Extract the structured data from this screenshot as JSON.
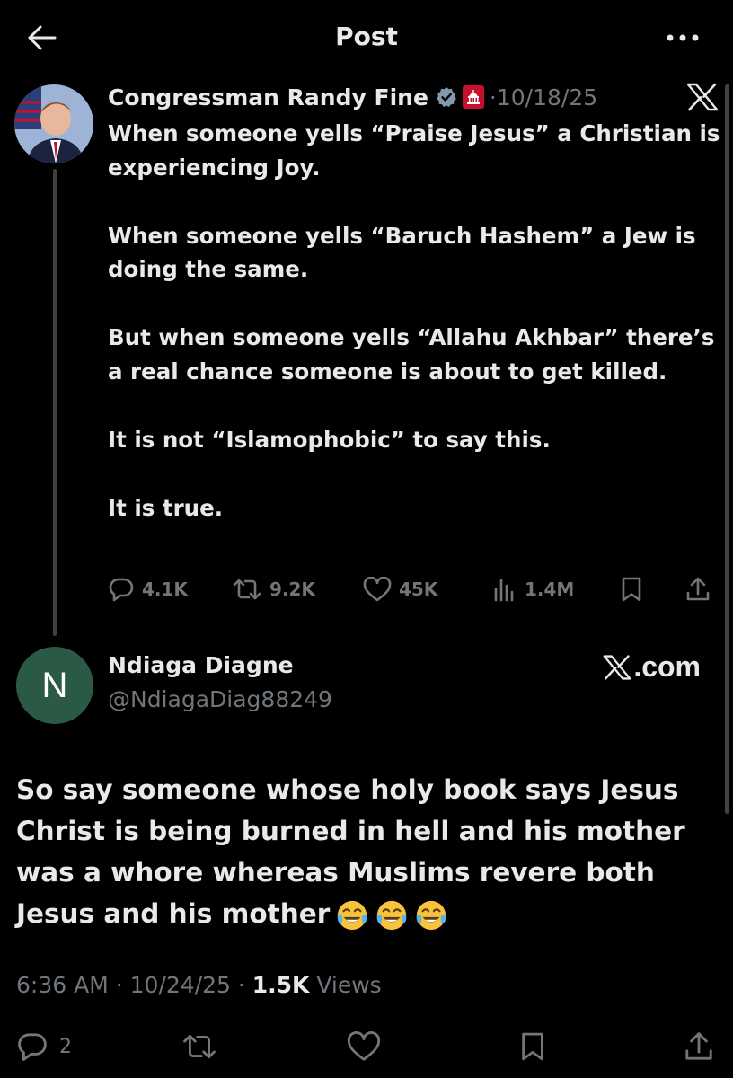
{
  "header": {
    "title": "Post",
    "back_icon": "arrow-left-icon",
    "more_icon": "more-dots-icon"
  },
  "parent_post": {
    "author_name": "Congressman Randy Fine",
    "date": "·10/18/25",
    "paragraphs": [
      "When someone yells “Praise Jesus” a Christian is experiencing Joy.",
      "When someone yells “Baruch Hashem” a Jew is doing the same.",
      "But when someone yells “Allahu Akhbar” there’s a real chance someone is about to get killed.",
      "It is not “Islamophobic” to say this.",
      "It is true."
    ],
    "actions": {
      "replies": "4.1K",
      "reposts": "9.2K",
      "likes": "45K",
      "views": "1.4M"
    }
  },
  "reply_post": {
    "avatar_letter": "N",
    "author_name": "Ndiaga Diagne",
    "handle": "@NdiagaDiag88249",
    "watermark": "𝕏.com",
    "watermark_text": ".com",
    "body": "So say someone whose holy book says Jesus Christ is being burned in hell and his mother was a whore whereas Muslims revere both Jesus and his mother",
    "emojis": [
      "face-with-tears-of-joy",
      "face-with-tears-of-joy",
      "face-with-tears-of-joy"
    ],
    "meta": {
      "time": "6:36 AM",
      "sep1": " · ",
      "date": "10/24/25",
      "sep2": " · ",
      "views_count": "1.5K",
      "views_label": " Views"
    },
    "actions": {
      "replies": "2"
    }
  },
  "colors": {
    "background": "#000000",
    "text": "#e7e9ea",
    "muted": "#71767b",
    "verified": "#829aab",
    "avatar_n": "#2a5a46"
  }
}
